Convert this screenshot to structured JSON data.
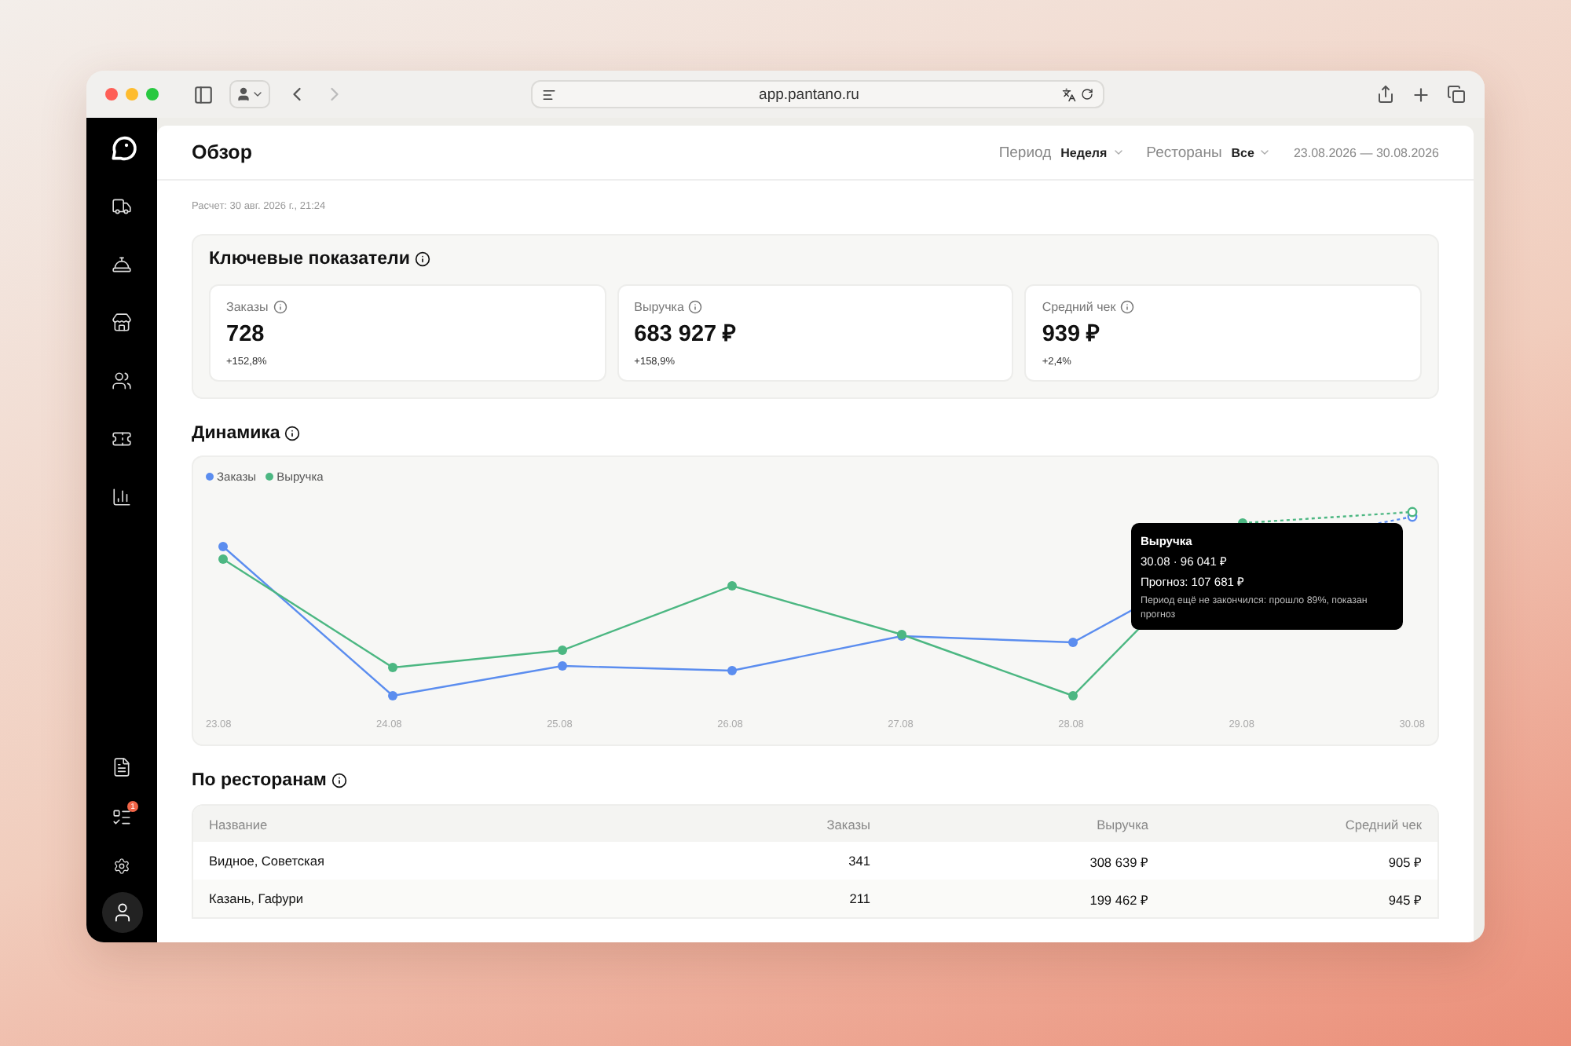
{
  "browser": {
    "url": "app.pantano.ru"
  },
  "sidebar": {
    "badge": "1"
  },
  "header": {
    "title": "Обзор",
    "filters": [
      {
        "label": "Период",
        "value": "Неделя"
      },
      {
        "label": "Рестораны",
        "value": "Все"
      }
    ],
    "date_range": "23.08.2026 — 30.08.2026"
  },
  "calculated_at": "Расчет: 30 авг. 2026 г., 21:24",
  "key_metrics": {
    "title": "Ключевые показатели",
    "cards": [
      {
        "label": "Заказы",
        "value": "728",
        "change": "+152,8%"
      },
      {
        "label": "Выручка",
        "value": "683 927 ₽",
        "change": "+158,9%"
      },
      {
        "label": "Средний чек",
        "value": "939 ₽",
        "change": "+2,4%"
      }
    ]
  },
  "dynamics": {
    "title": "Динамика",
    "legend": [
      {
        "name": "Заказы",
        "color": "#5b8def"
      },
      {
        "name": "Выручка",
        "color": "#4cb782"
      }
    ],
    "x_labels": [
      "23.08",
      "24.08",
      "25.08",
      "26.08",
      "27.08",
      "28.08",
      "29.08",
      "30.08"
    ],
    "tooltip": {
      "title": "Выручка",
      "line_1": "30.08 · 96 041 ₽",
      "line_2": "Прогноз: 107 681 ₽",
      "note": "Период ещё не закончился: прошло 89%, показан прогноз"
    }
  },
  "restaurants": {
    "title": "По ресторанам",
    "columns": [
      "Название",
      "Заказы",
      "Выручка",
      "Средний чек"
    ],
    "rows": [
      [
        "Видное, Советская",
        "341",
        "308 639 ₽",
        "905 ₽"
      ],
      [
        "Казань, Гафури",
        "211",
        "199 462 ₽",
        "945 ₽"
      ]
    ]
  }
}
